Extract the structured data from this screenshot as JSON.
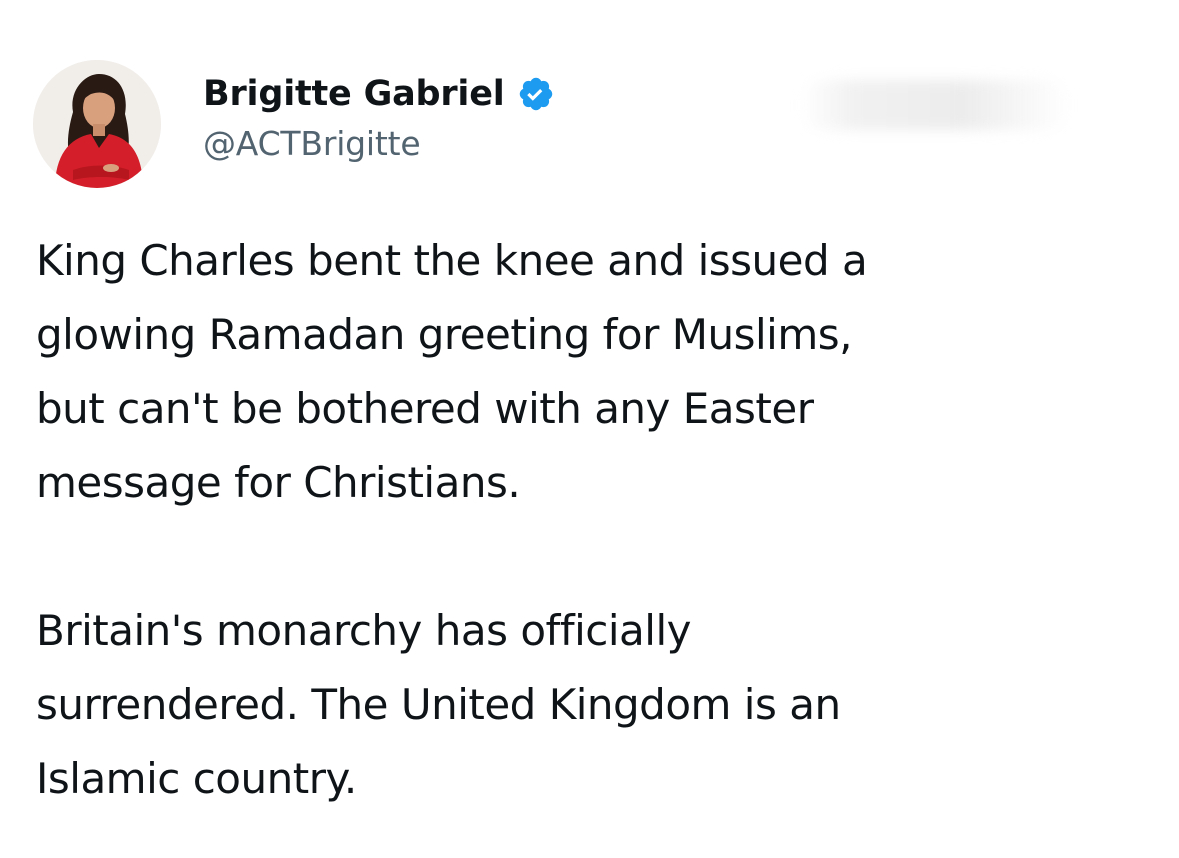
{
  "tweet": {
    "author": {
      "display_name": "Brigitte Gabriel",
      "handle": "@ACTBrigitte",
      "verified": true,
      "avatar_icon": "profile-photo"
    },
    "paragraphs": [
      "King Charles bent the knee and issued a\nglowing Ramadan greeting for Muslims,\nbut can't be bothered with any Easter\nmessage for Christians.",
      "Britain's monarchy has officially\nsurrendered. The United Kingdom is an\nIslamic country."
    ]
  },
  "colors": {
    "text_primary": "#0f1419",
    "text_secondary": "#536471",
    "verified_badge": "#1d9bf0",
    "background": "#ffffff"
  }
}
